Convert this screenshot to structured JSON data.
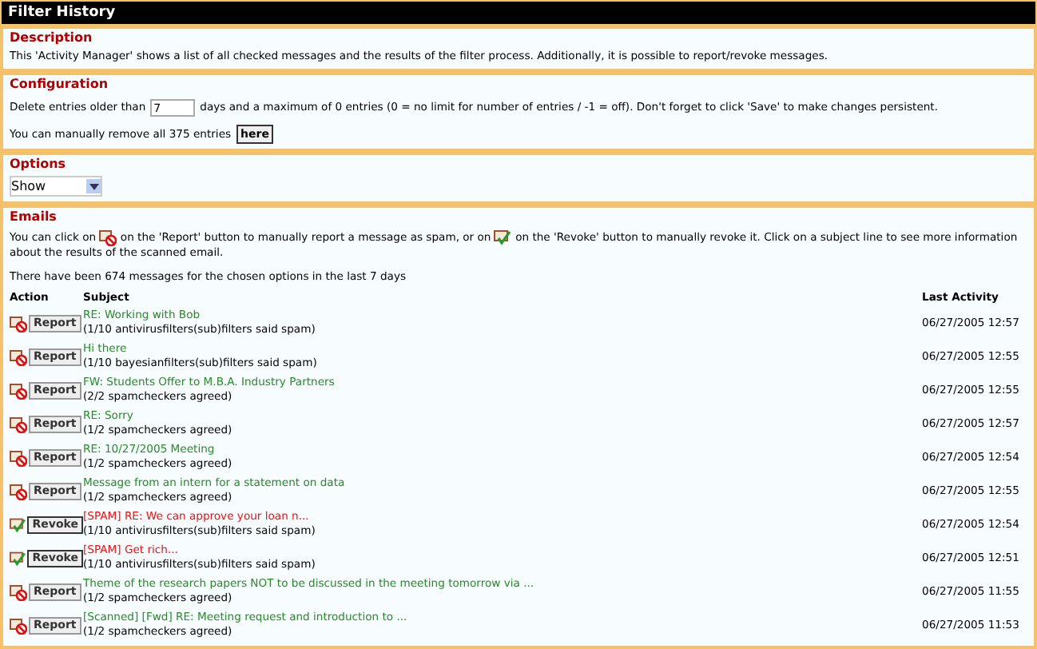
{
  "window": {
    "title": "Filter History"
  },
  "description": {
    "heading": "Description",
    "text": "This 'Activity Manager' shows a list of all checked messages and the results of the filter process. Additionally, it is possible to report/revoke messages."
  },
  "configuration": {
    "heading": "Configuration",
    "before": "Delete entries older than",
    "days": "7",
    "after": "days and a maximum of 0 entries (0 = no limit for number of entries / -1 = off). Don't forget to click 'Save' to make changes persistent.",
    "remove_text": "You can manually remove all 375 entries",
    "remove_button": "here"
  },
  "options": {
    "heading": "Options",
    "select": "Show"
  },
  "emails": {
    "heading": "Emails",
    "intro_a": "You can click on",
    "intro_b": "on the 'Report' button to manually report a message as spam, or on",
    "intro_c": "on the 'Revoke' button to manually revoke it. Click on a subject line to see more information about the results of the scanned email.",
    "summary": "There have been 674 messages for the chosen options in the last 7 days",
    "columns": [
      "Action",
      "Subject",
      "Last Activity"
    ],
    "rows": [
      {
        "kind": "report",
        "button": "Report",
        "subject": "RE: Working with Bob",
        "detail": "(1/10 antivirusfilters(sub)filters said spam)",
        "time": "06/27/2005 12:57"
      },
      {
        "kind": "report",
        "button": "Report",
        "subject": "Hi there",
        "detail": "(1/10 bayesianfilters(sub)filters said spam)",
        "time": "06/27/2005 12:55"
      },
      {
        "kind": "report",
        "button": "Report",
        "subject": "FW: Students Offer to M.B.A. Industry Partners",
        "detail": "(2/2 spamcheckers agreed)",
        "time": "06/27/2005 12:55"
      },
      {
        "kind": "report",
        "button": "Report",
        "subject": "RE: Sorry",
        "detail": "(1/2 spamcheckers agreed)",
        "time": "06/27/2005 12:57"
      },
      {
        "kind": "report",
        "button": "Report",
        "subject": "RE: 10/27/2005 Meeting",
        "detail": "(1/2 spamcheckers agreed)",
        "time": "06/27/2005 12:54"
      },
      {
        "kind": "report",
        "button": "Report",
        "subject": "Message from an intern for a statement on data",
        "detail": "(1/2 spamcheckers agreed)",
        "time": "06/27/2005 12:55"
      },
      {
        "kind": "revoke",
        "button": "Revoke",
        "subject": "[SPAM] RE: We can approve your loan n...",
        "detail": "(1/10 antivirusfilters(sub)filters said spam)",
        "time": "06/27/2005 12:54"
      },
      {
        "kind": "revoke",
        "button": "Revoke",
        "subject": "[SPAM] Get rich...",
        "detail": "(1/10 antivirusfilters(sub)filters said spam)",
        "time": "06/27/2005 12:51"
      },
      {
        "kind": "report",
        "button": "Report",
        "subject": "Theme of the research papers NOT to be discussed in the meeting tomorrow via ...",
        "detail": "(1/2 spamcheckers agreed)",
        "time": "06/27/2005 11:55"
      },
      {
        "kind": "report",
        "button": "Report",
        "subject": "[Scanned] [Fwd] RE: Meeting request and introduction to ...",
        "detail": "(1/2 spamcheckers agreed)",
        "time": "06/27/2005 11:53"
      }
    ]
  }
}
